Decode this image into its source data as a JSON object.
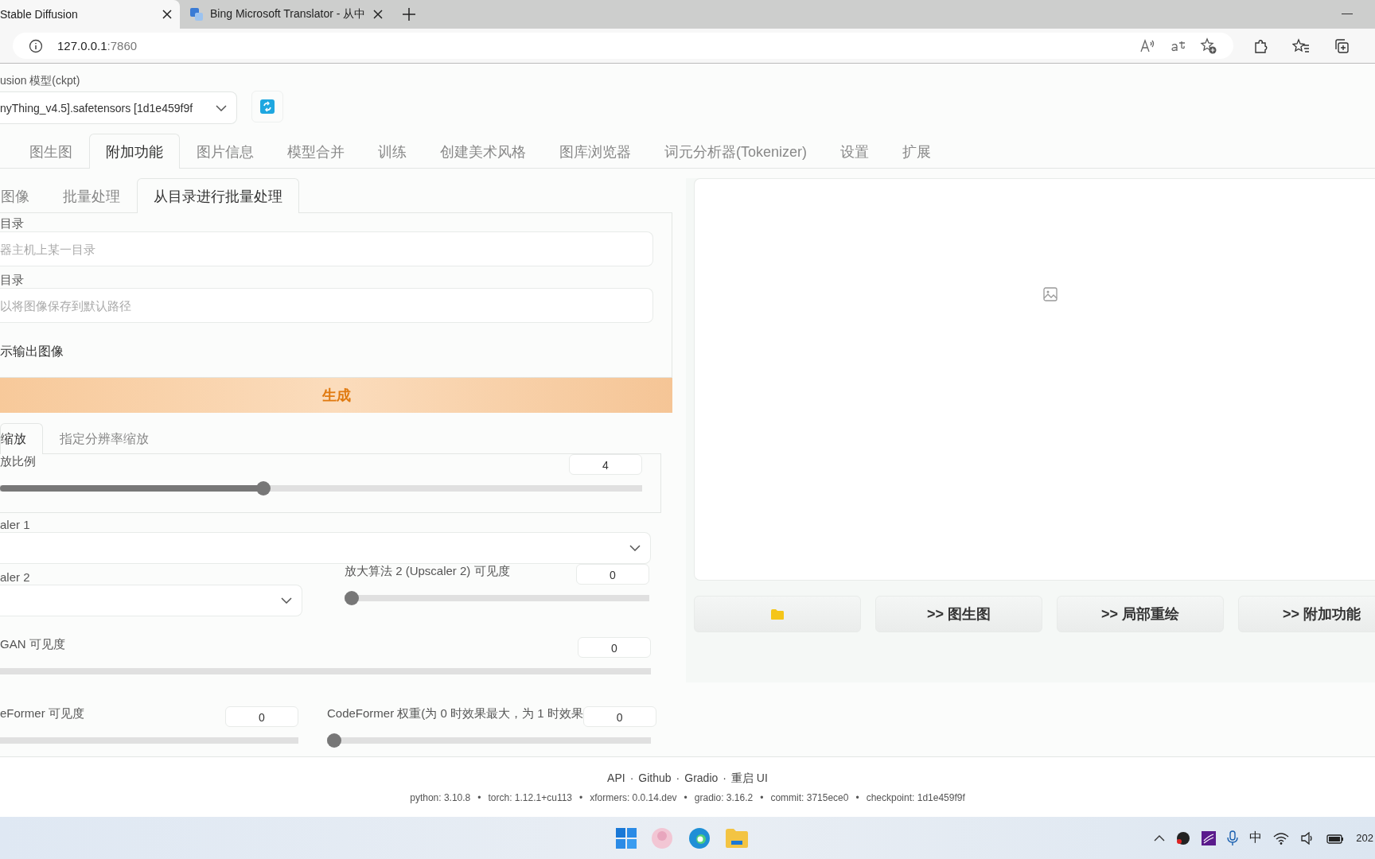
{
  "browser": {
    "tabs": [
      {
        "title": "Stable Diffusion",
        "selected": true
      },
      {
        "title": "Bing Microsoft Translator - 从中",
        "selected": false
      }
    ],
    "address": {
      "host": "127.0.0.1",
      "port": ":7860"
    }
  },
  "model": {
    "label": "usion 模型(ckpt)",
    "value": "nyThing_v4.5].safetensors [1d1e459f9f"
  },
  "main_tabs": [
    {
      "label": "图生图",
      "selected": false
    },
    {
      "label": "附加功能",
      "selected": true
    },
    {
      "label": "图片信息",
      "selected": false
    },
    {
      "label": "模型合并",
      "selected": false
    },
    {
      "label": "训练",
      "selected": false
    },
    {
      "label": "创建美术风格",
      "selected": false
    },
    {
      "label": "图库浏览器",
      "selected": false
    },
    {
      "label": "词元分析器(Tokenizer)",
      "selected": false
    },
    {
      "label": "设置",
      "selected": false
    },
    {
      "label": "扩展",
      "selected": false
    }
  ],
  "sub_tabs": [
    {
      "label": "图像",
      "selected": false
    },
    {
      "label": "批量处理",
      "selected": false
    },
    {
      "label": "从目录进行批量处理",
      "selected": true
    }
  ],
  "batch_dir": {
    "fields": [
      {
        "label": "目录",
        "placeholder": "器主机上某一目录"
      },
      {
        "label": "目录",
        "placeholder": "以将图像保存到默认路径"
      }
    ],
    "checkbox_label": "示输出图像"
  },
  "generate_button": "生成",
  "resize_tabs": [
    {
      "label": "缩放",
      "selected": true
    },
    {
      "label": "指定分辨率缩放",
      "selected": false
    }
  ],
  "scale": {
    "label": "放比例",
    "value": "4",
    "level": 0.41
  },
  "upscaler1": {
    "label": "aler 1"
  },
  "upscaler2": {
    "label": "aler 2"
  },
  "upscaler2_visibility": {
    "label": "放大算法 2 (Upscaler 2) 可见度",
    "value": "0",
    "level": 0
  },
  "gfpgan_visibility": {
    "label": "GAN 可见度",
    "value": "0"
  },
  "codeformer_visibility": {
    "label": "eFormer 可见度",
    "value": "0"
  },
  "codeformer_weight": {
    "label": "CodeFormer 权重(为 0 时效果最大，为 1 时效果",
    "value": "0",
    "level": 0
  },
  "output": {
    "buttons": [
      {
        "kind": "folder"
      },
      {
        "kind": "text",
        "label": ">> 图生图"
      },
      {
        "kind": "text",
        "label": ">> 局部重绘"
      },
      {
        "kind": "text",
        "label": ">> 附加功能"
      }
    ]
  },
  "footer": {
    "links": [
      "API",
      "Github",
      "Gradio",
      "重启 UI"
    ],
    "link_separator": "·",
    "versions": [
      "python: 3.10.8",
      "torch: 1.12.1+cu113",
      "xformers: 0.0.14.dev",
      "gradio: 3.16.2",
      "commit: 3715ece0",
      "checkpoint: 1d1e459f9f"
    ],
    "version_separator": "•"
  },
  "taskbar": {
    "input_method": "中",
    "clock": "202"
  }
}
